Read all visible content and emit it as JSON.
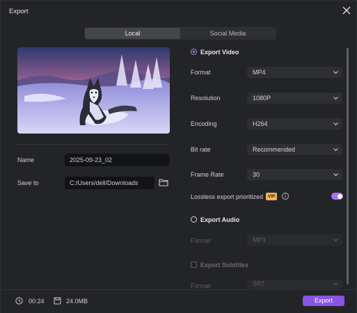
{
  "window": {
    "title": "Export"
  },
  "tabs": [
    {
      "label": "Local",
      "active": true
    },
    {
      "label": "Social Media",
      "active": false
    }
  ],
  "left": {
    "name_label": "Name",
    "name_value": "2025-09-23_02",
    "save_label": "Save to",
    "save_value": "C:/Users/dell/Downloads"
  },
  "video": {
    "title": "Export Video",
    "format_label": "Format",
    "format_value": "MP4",
    "resolution_label": "Resolution",
    "resolution_value": "1080P",
    "encoding_label": "Encoding",
    "encoding_value": "H264",
    "bitrate_label": "Bit rate",
    "bitrate_value": "Recommended",
    "framerate_label": "Frame Rate",
    "framerate_value": "30",
    "lossless_label": "Lossless export prioritized",
    "vip_badge": "VIP",
    "info_glyph": "i",
    "lossless_enabled": true
  },
  "audio": {
    "title": "Export Audio",
    "format_label": "Format",
    "format_value": "MP3"
  },
  "subtitles": {
    "title": "Export Subtitles",
    "format_label": "Format",
    "format_value": "SRT"
  },
  "footer": {
    "duration": "00:24",
    "size": "24.0MB",
    "export_label": "Export"
  },
  "colors": {
    "accent": "#8b54e6",
    "radio": "#b38bf4",
    "vip": "#f2b35c"
  }
}
